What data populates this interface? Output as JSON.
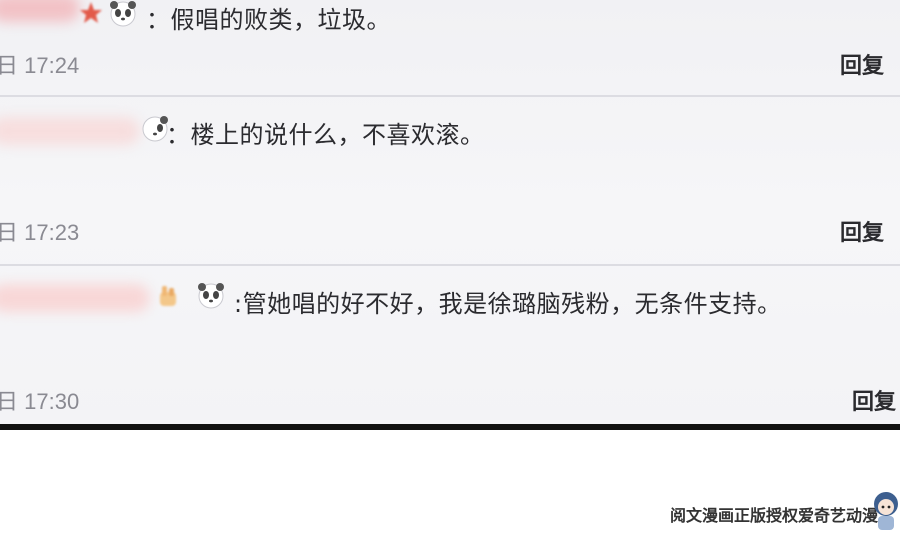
{
  "comments": [
    {
      "text": "：假唱的败类，垃圾。",
      "time_prefix": "日",
      "time": "17:24",
      "reply_label": "回复"
    },
    {
      "text": "：楼上的说什么，不喜欢滚。",
      "time_prefix": "日",
      "time": "17:23",
      "reply_label": "回复"
    },
    {
      "text": ":管她唱的好不好，我是徐璐脑残粉，无条件支持。",
      "time_prefix": "日",
      "time": "17:30",
      "reply_label": "回复"
    }
  ],
  "footer": {
    "watermark": "阅文漫画正版授权爱奇艺动漫"
  },
  "colors": {
    "background": "#f3f3f6",
    "text": "#2b2b2f",
    "time": "#8a8a92",
    "divider": "#dcdce2",
    "frame_border": "#111111"
  },
  "icons": [
    "star-badge-icon",
    "panda-emoji-icon",
    "hand-badge-icon"
  ]
}
